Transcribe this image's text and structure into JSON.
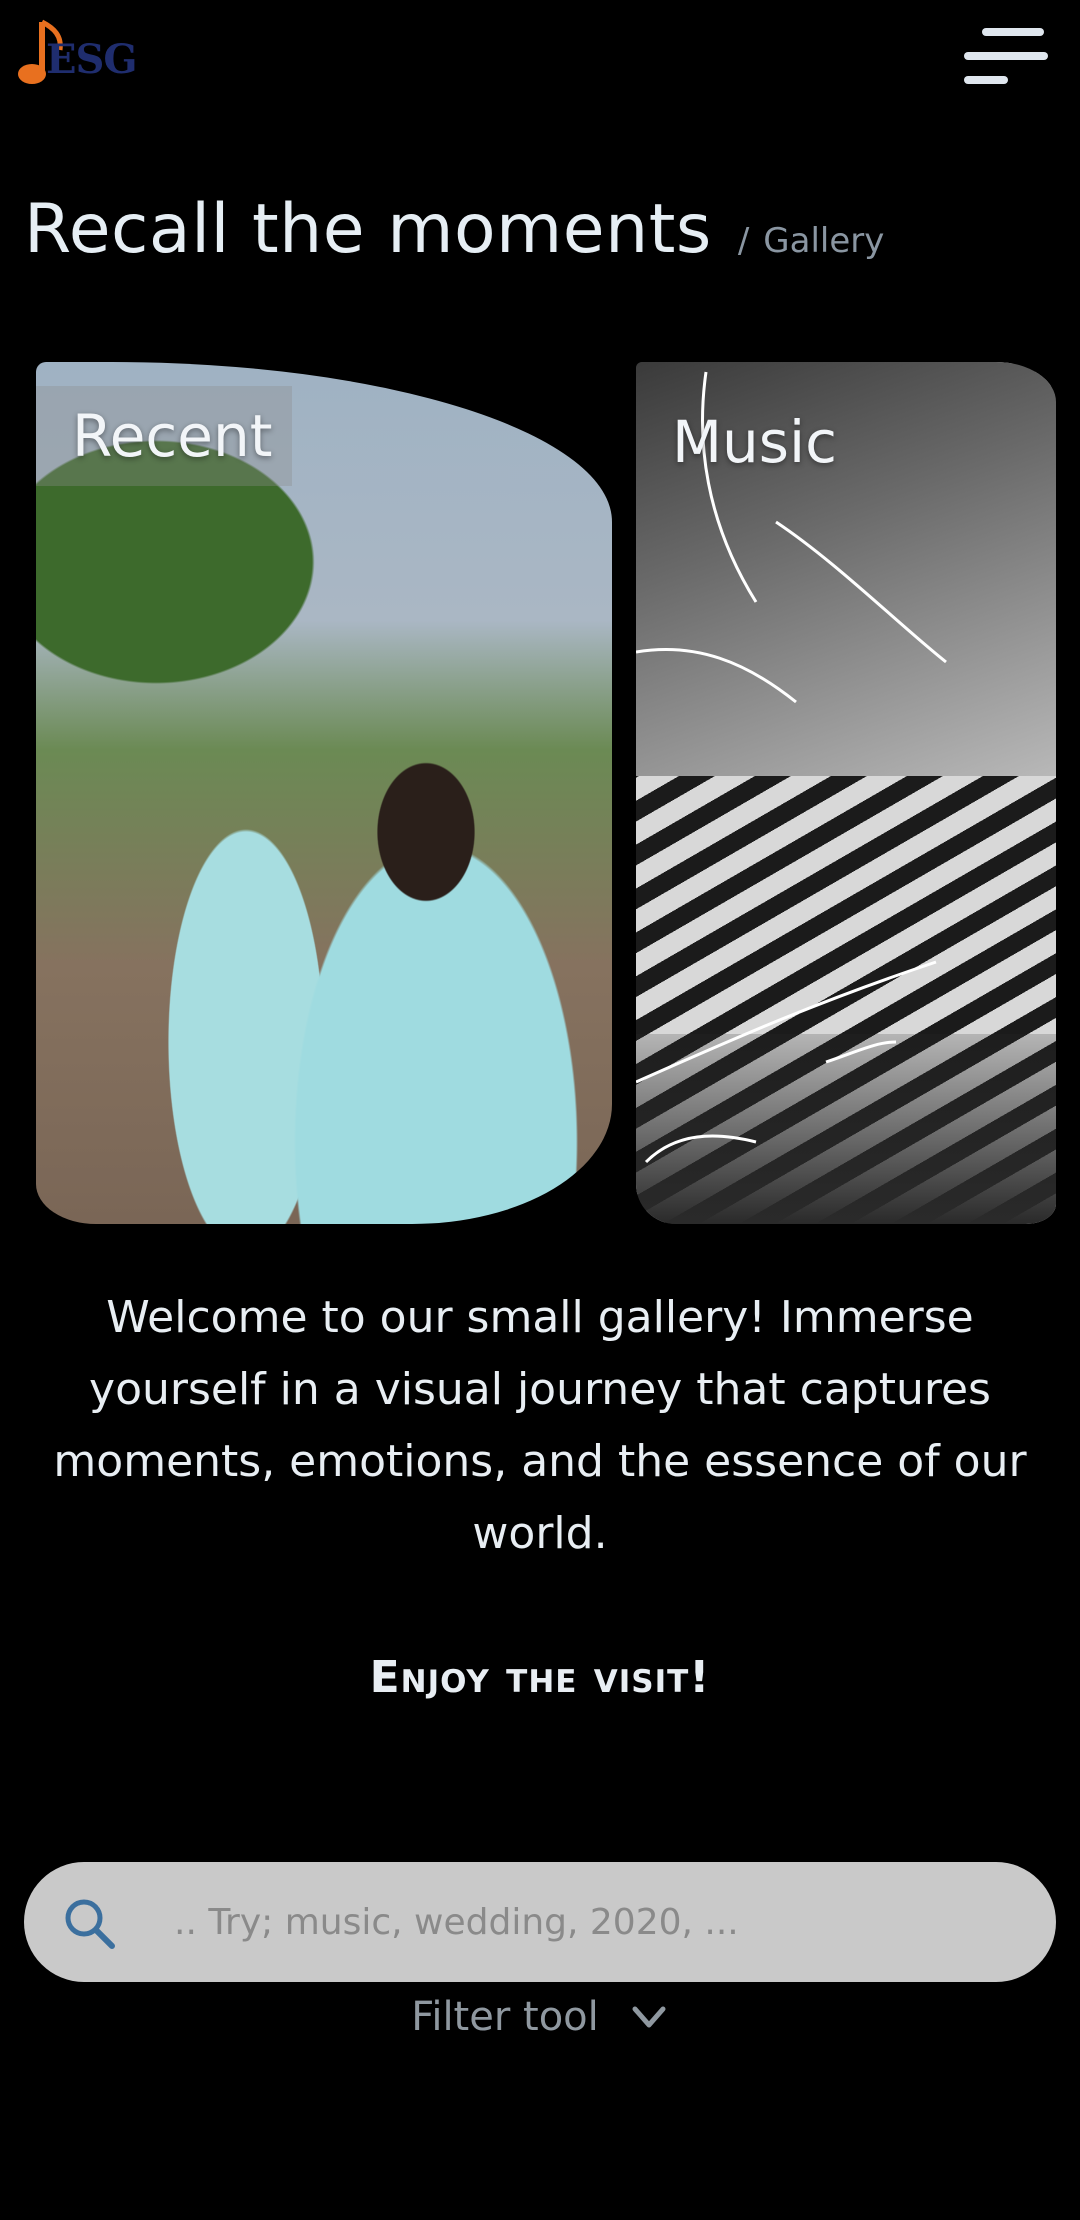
{
  "header": {
    "logo_text": "ESG",
    "logo_icon": "music-note-icon",
    "menu_icon": "hamburger-menu-icon"
  },
  "title": {
    "main": "Recall the moments",
    "separator": "/",
    "breadcrumb": "Gallery"
  },
  "cards": [
    {
      "label": "Recent"
    },
    {
      "label": "Music"
    }
  ],
  "welcome_text": "Welcome to our small gallery! Immerse yourself in a visual journey that captures moments, emotions, and the essence of our world.",
  "enjoy_text": "Enjoy the visit!",
  "search": {
    "placeholder": ".. Try; music, wedding, 2020, ...",
    "icon": "search-icon"
  },
  "filter": {
    "label": "Filter tool",
    "icon": "chevron-down-icon"
  },
  "colors": {
    "background": "#000000",
    "text": "#e8eef3",
    "muted": "#8a96a2",
    "search_bg": "#c9c9c9",
    "search_icon": "#3b6f9e",
    "logo_orange": "#e8701f",
    "logo_navy": "#1f2d6e"
  }
}
